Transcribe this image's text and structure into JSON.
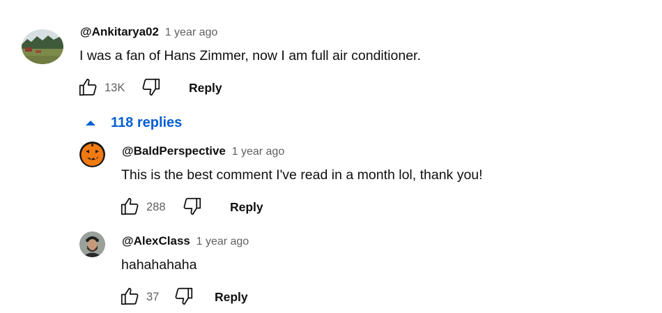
{
  "comments": [
    {
      "author": "@Ankitarya02",
      "time": "1 year ago",
      "text": "I was a fan of Hans Zimmer, now I am full air conditioner.",
      "likes": "13K",
      "reply_label": "Reply",
      "avatar_icon": "landscape-photo-avatar"
    }
  ],
  "replies_toggle": {
    "label": "118 replies",
    "icon": "caret-up-icon",
    "color": "#065fd4"
  },
  "replies": [
    {
      "author": "@BaldPerspective",
      "time": "1 year ago",
      "text": "This is the best comment I've read in a month lol, thank you!",
      "likes": "288",
      "reply_label": "Reply",
      "avatar_icon": "jack-o-lantern-avatar"
    },
    {
      "author": "@AlexClass",
      "time": "1 year ago",
      "text": "hahahahaha",
      "likes": "37",
      "reply_label": "Reply",
      "avatar_icon": "person-photo-avatar"
    }
  ]
}
